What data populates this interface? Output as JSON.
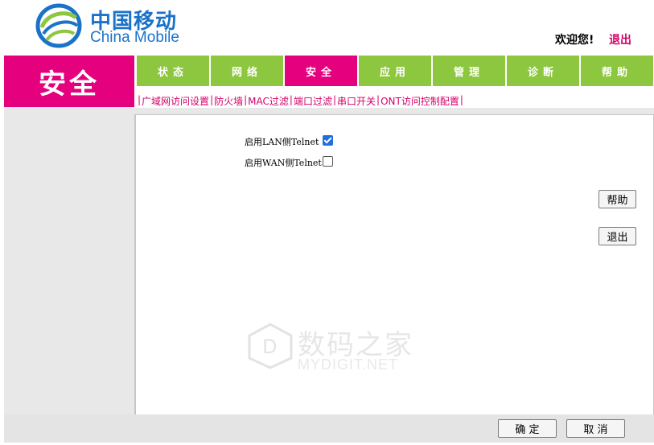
{
  "header": {
    "logo_cn": "中国移动",
    "logo_en": "China Mobile",
    "welcome": "欢迎您!",
    "logout": "退出"
  },
  "section_title": "安全",
  "nav": {
    "tabs": [
      {
        "label": "状态",
        "active": false
      },
      {
        "label": "网络",
        "active": false
      },
      {
        "label": "安全",
        "active": true
      },
      {
        "label": "应用",
        "active": false
      },
      {
        "label": "管理",
        "active": false
      },
      {
        "label": "诊断",
        "active": false
      },
      {
        "label": "帮助",
        "active": false
      }
    ]
  },
  "subnav": {
    "items": [
      "广域网访问设置",
      "防火墙",
      "MAC过滤",
      "端口过滤",
      "串口开关",
      "ONT访问控制配置"
    ]
  },
  "form": {
    "lan_telnet_label": "启用LAN侧Telnet",
    "lan_telnet_checked": true,
    "wan_telnet_label": "启用WAN侧Telnet",
    "wan_telnet_checked": false
  },
  "side_buttons": {
    "help": "帮助",
    "exit": "退出"
  },
  "footer": {
    "confirm": "确 定",
    "cancel": "取 消"
  },
  "watermark": {
    "cn": "数码之家",
    "en": "MYDIGIT.NET"
  },
  "colors": {
    "brand_pink": "#e5007e",
    "nav_green": "#8dc63f",
    "brand_blue": "#1a73c8"
  }
}
